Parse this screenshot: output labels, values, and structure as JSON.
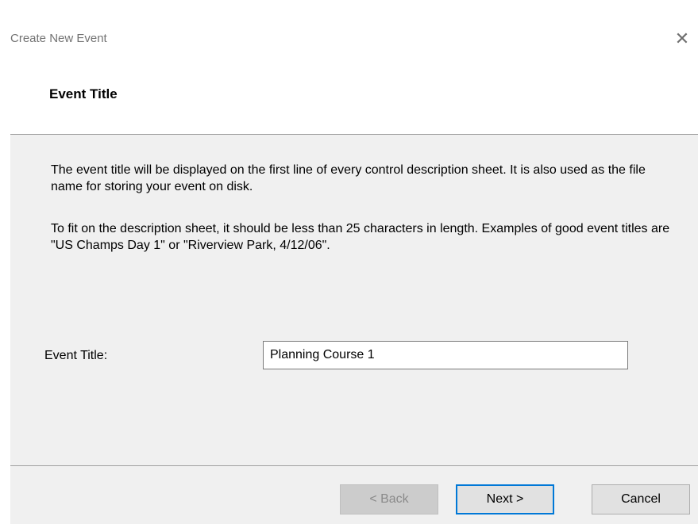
{
  "window": {
    "title": "Create New Event",
    "close_glyph": "✕"
  },
  "header": {
    "title": "Event Title"
  },
  "body": {
    "description_1": "The event title will be displayed on the first line of every control description sheet. It is also used as the file name for storing your event on disk.",
    "description_2": "To fit on the description sheet, it should be less than 25 characters in length. Examples of good event titles are \"US Champs Day 1\" or \"Riverview Park, 4/12/06\".",
    "field_label": "Event Title:",
    "field_value": "Planning Course 1"
  },
  "buttons": {
    "back": {
      "label": "< Back",
      "enabled": false
    },
    "next": {
      "label": "Next >",
      "enabled": true,
      "focused": true
    },
    "cancel": {
      "label": "Cancel",
      "enabled": true
    }
  },
  "colors": {
    "panel_background": "#f0f0f0",
    "focus_border": "#0078d7",
    "disabled_button": "#cccccc"
  }
}
